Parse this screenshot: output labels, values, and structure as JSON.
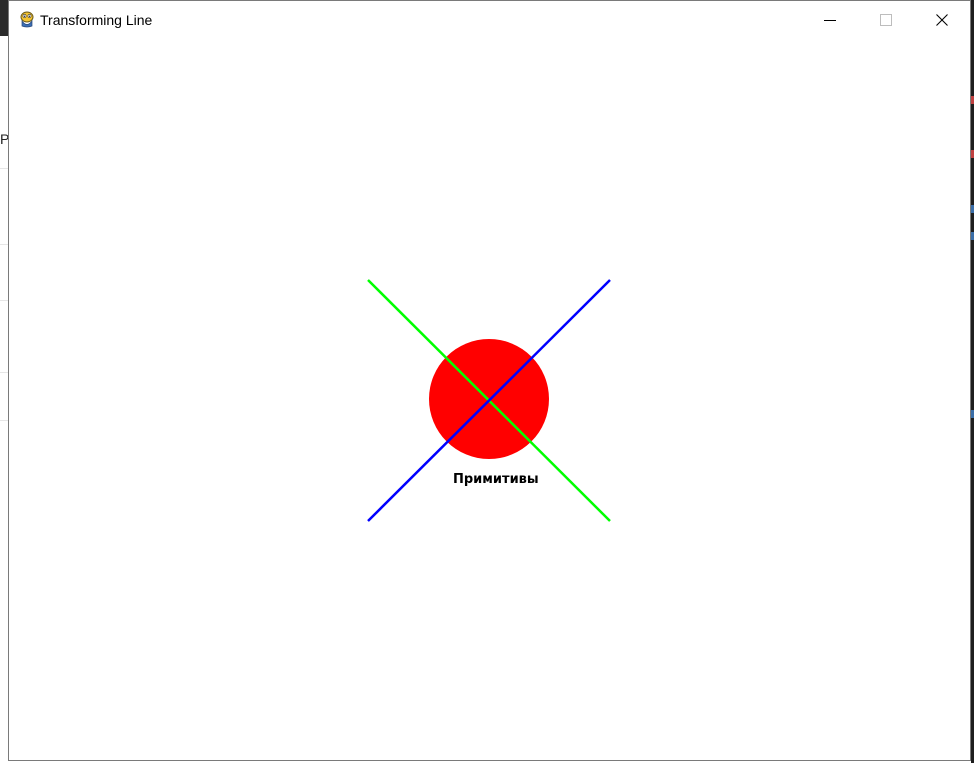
{
  "window": {
    "title": "Transforming Line",
    "app_icon": "pygame-snake-icon"
  },
  "controls": {
    "minimize_icon": "minimize-icon",
    "maximize_icon": "maximize-icon",
    "close_icon": "close-icon"
  },
  "scene": {
    "caption": "Примитивы",
    "circle_color": "#ff0000",
    "line1_color": "#00ff00",
    "line2_color": "#0000ff",
    "background_color": "#ffffff"
  }
}
